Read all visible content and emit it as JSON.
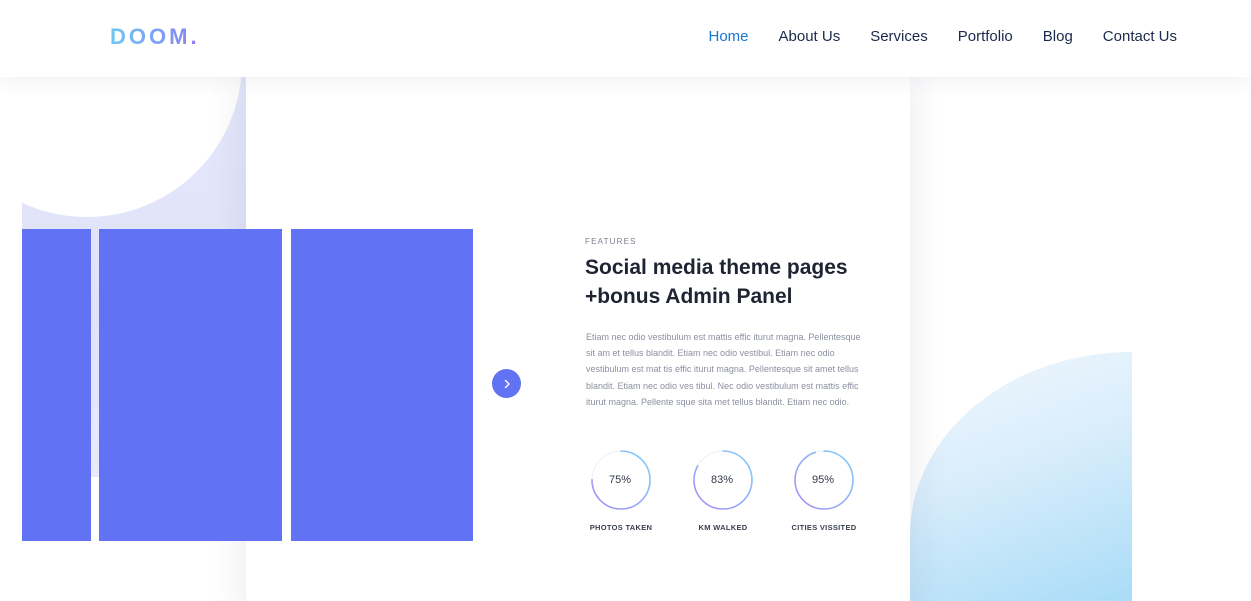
{
  "brand": {
    "logo_text": "DOOM."
  },
  "nav": {
    "items": [
      {
        "label": "Home",
        "active": true
      },
      {
        "label": "About Us",
        "active": false
      },
      {
        "label": "Services",
        "active": false
      },
      {
        "label": "Portfolio",
        "active": false
      },
      {
        "label": "Blog",
        "active": false
      },
      {
        "label": "Contact Us",
        "active": false
      }
    ]
  },
  "feature": {
    "eyebrow": "FEATURES",
    "title_line1": "Social media theme pages",
    "title_line2": "+bonus Admin Panel",
    "body": "Etiam nec odio vestibulum est mattis effic iturut magna. Pellentesque sit am et tellus blandit. Etiam nec odio vestibul. Etiam nec odio vestibulum est mat tis effic iturut magna. Pellentesque sit amet tellus blandit. Etiam nec odio ves tibul.  Nec odio vestibulum est mattis effic iturut magna. Pellente sque sita met tellus blandit. Etiam nec odio."
  },
  "stats": [
    {
      "value": "75%",
      "fraction": 0.75,
      "label": "PHOTOS TAKEN"
    },
    {
      "value": "83%",
      "fraction": 0.83,
      "label": "KM WALKED"
    },
    {
      "value": "95%",
      "fraction": 0.95,
      "label": "CITIES VISSITED"
    }
  ],
  "colors": {
    "accent": "#6272f4",
    "nav_active": "#1976d2",
    "nav_text": "#1a2a4a",
    "ring_start": "#a98cf5",
    "ring_end": "#7fd0f7"
  },
  "icons": {
    "next": "chevron-right-icon"
  }
}
